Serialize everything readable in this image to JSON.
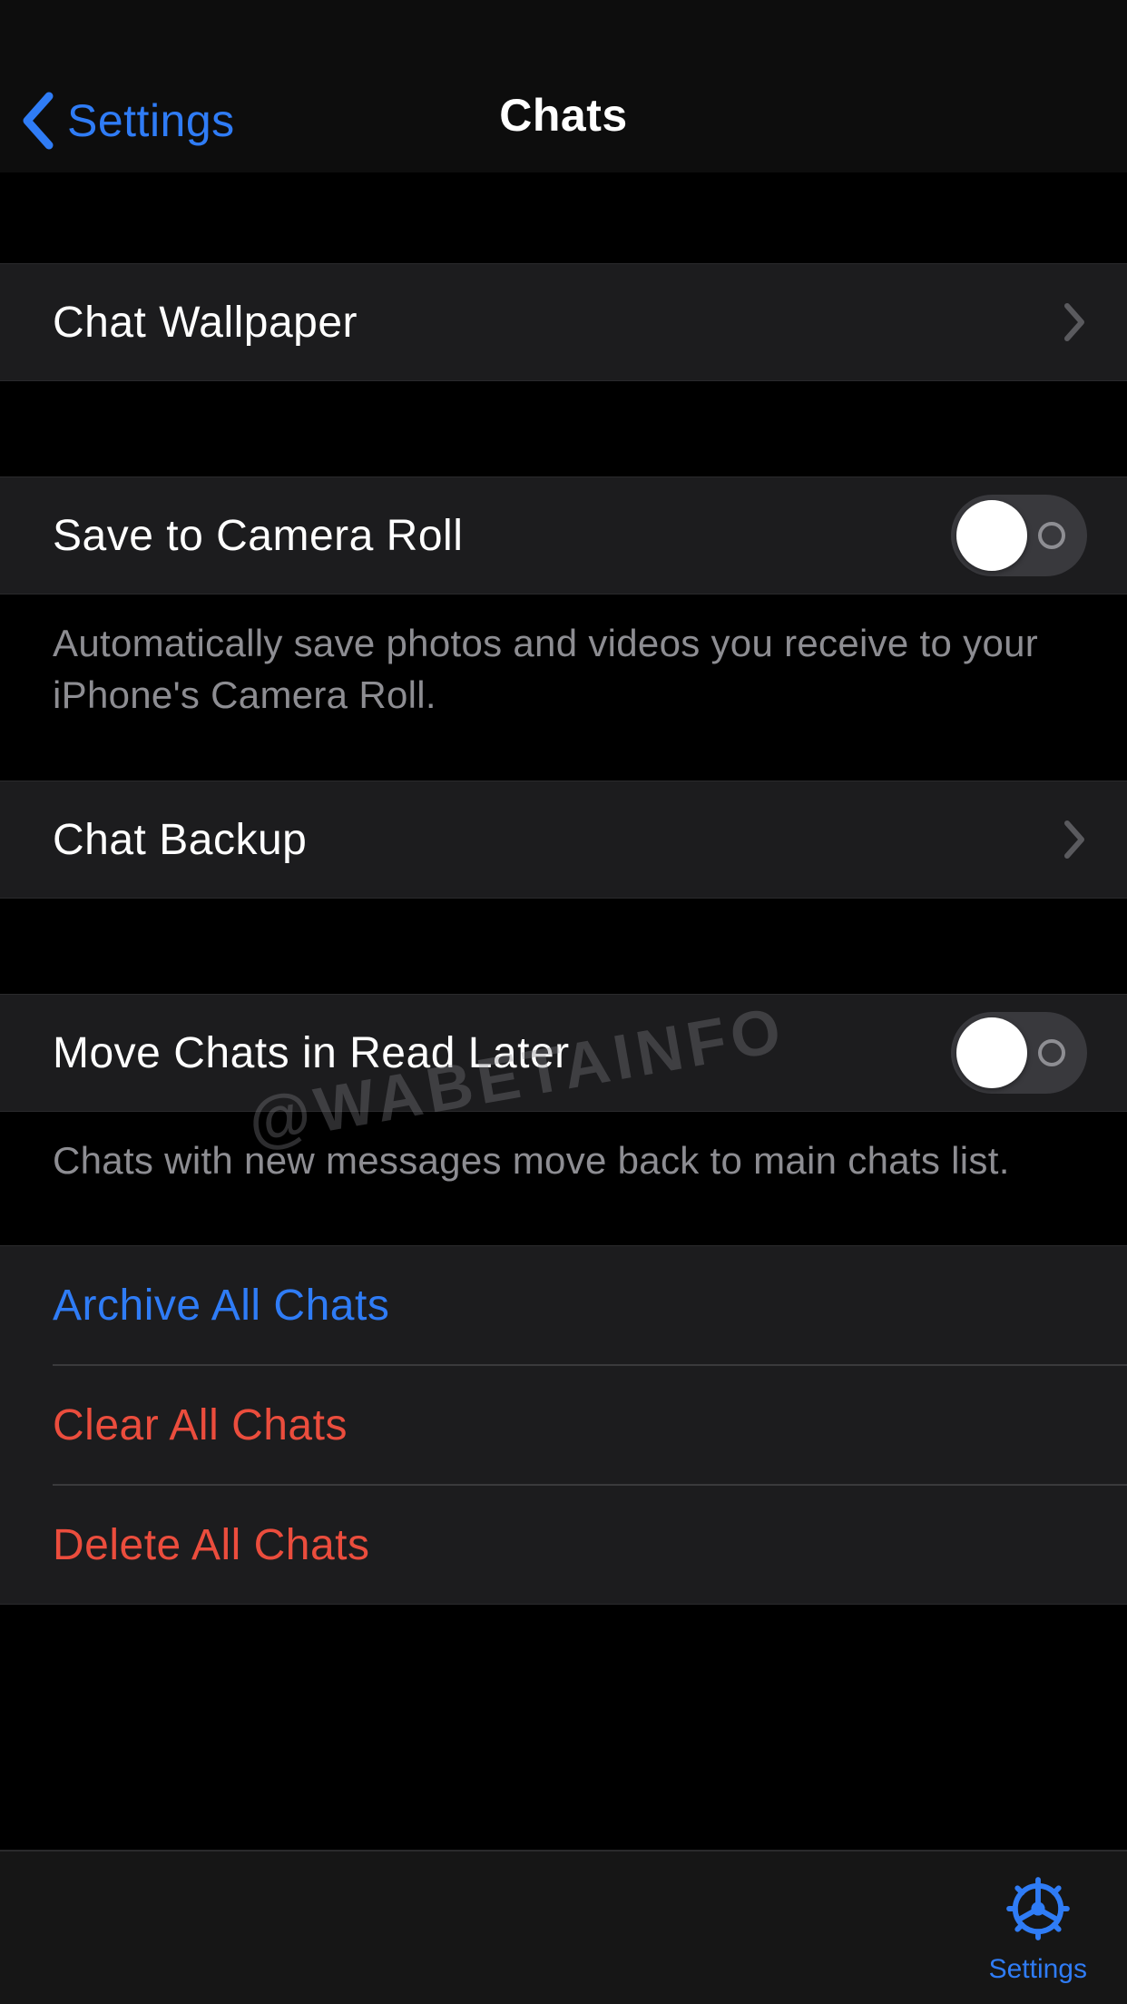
{
  "nav": {
    "back_label": "Settings",
    "title": "Chats"
  },
  "rows": {
    "wallpaper": "Chat Wallpaper",
    "save_camera": "Save to Camera Roll",
    "save_camera_footer": "Automatically save photos and videos you receive to your iPhone's Camera Roll.",
    "backup": "Chat Backup",
    "read_later": "Move Chats in Read Later",
    "read_later_footer": "Chats with new messages move back to main chats list."
  },
  "toggles": {
    "save_camera_on": false,
    "read_later_on": false
  },
  "actions": {
    "archive": "Archive All Chats",
    "clear": "Clear All Chats",
    "delete": "Delete All Chats"
  },
  "tabbar": {
    "settings": "Settings"
  },
  "watermark": "@WABETAINFO",
  "colors": {
    "accent_blue": "#2f7cf6",
    "destructive_red": "#eb4d3d",
    "cell_bg": "#1c1c1e"
  }
}
